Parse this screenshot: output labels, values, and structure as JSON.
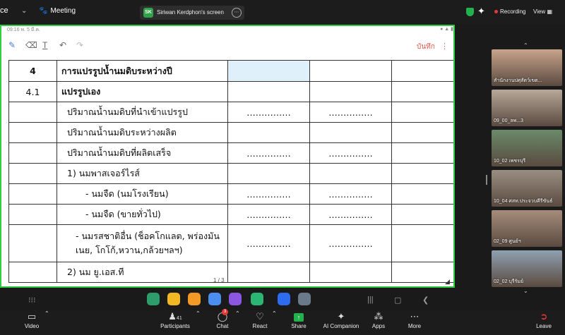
{
  "topbar": {
    "left_fragment": "ce",
    "meeting_label": "Meeting",
    "share_initials": "SK",
    "share_name": "Siriwan Kerdphon's screen",
    "recording_label": "Recording",
    "view_label": "View"
  },
  "tablet": {
    "status_time": "09:16 พ. 5 มี.ค.",
    "save_label": "บันทึก",
    "pager": "1 / 3",
    "rows": [
      {
        "no": "4",
        "item": "การแปรรูปน้ำนมดิบระหว่างปี",
        "a": "",
        "b": ""
      },
      {
        "no": "4.1",
        "item": "แปรรูปเอง",
        "a": "",
        "b": ""
      },
      {
        "no": "",
        "item": "ปริมาณน้ำนมดิบที่นำเข้าแปรรูป",
        "a": "……………",
        "b": "……………"
      },
      {
        "no": "",
        "item": "ปริมาณน้ำนมดิบระหว่างผลิต",
        "a": "",
        "b": ""
      },
      {
        "no": "",
        "item": "ปริมาณน้ำนมดิบที่ผลิตเสร็จ",
        "a": "……………",
        "b": "……………"
      },
      {
        "no": "",
        "item": "1)  นมพาสเจอร์ไรส์",
        "a": "",
        "b": ""
      },
      {
        "no": "",
        "item": "- นมจืด (นมโรงเรียน)",
        "a": "……………",
        "b": "……………"
      },
      {
        "no": "",
        "item": "- นมจืด (ขายทั่วไป)",
        "a": "……………",
        "b": "……………"
      },
      {
        "no": "",
        "item": "- นมรสชาติอื่น (ช็อคโกแลต, พร่องมันเนย, โกโก้,หวาน,กล้วยฯลฯ)",
        "a": "……………",
        "b": "……………"
      },
      {
        "no": "",
        "item": "2)  นม ยู.เอส.ที",
        "a": "",
        "b": ""
      }
    ]
  },
  "gallery": [
    {
      "label": "สำนักงานปศุสัตว์เขต...",
      "color": "#c8a48b"
    },
    {
      "label": "09_00_ลพ...3",
      "color": "#b7a89a"
    },
    {
      "label": "10_02 เพชรบุรี",
      "color": "#6a8a6a"
    },
    {
      "label": "10_04 ศสท.ประจวบคีรีขันธ์",
      "color": "#9a8e82"
    },
    {
      "label": "02_09 ศูนย์ฯ",
      "color": "#a68c7a"
    },
    {
      "label": "02_02 บุรีรัมย์",
      "color": "#8fa0b0"
    }
  ],
  "bottombar": {
    "video_label": "Video",
    "participants_label": "Participants",
    "participants_count": "41",
    "chat_label": "Chat",
    "chat_badge": "3",
    "react_label": "React",
    "share_label": "Share",
    "ai_label": "AI Companion",
    "apps_label": "Apps",
    "more_label": "More",
    "leave_label": "Leave"
  },
  "colors": {
    "share_border": "#2ecc40",
    "recording_dot": "#e53935",
    "share_button": "#22b14c",
    "highlight_cell": "#dff0fb",
    "save_text": "#e2584b"
  },
  "icons": [
    "paw-icon",
    "shield-icon",
    "sparkle-icon",
    "pen-icon",
    "eraser-icon",
    "text-icon",
    "undo-icon",
    "redo-icon",
    "video-icon",
    "participants-icon",
    "chat-icon",
    "react-icon",
    "share-screen-icon",
    "ai-companion-icon",
    "apps-icon",
    "more-icon",
    "leave-icon"
  ]
}
